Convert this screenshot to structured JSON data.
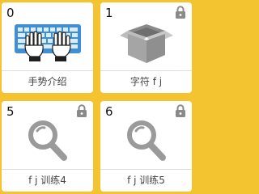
{
  "lessons": [
    {
      "number": "0",
      "label": "手势介绍",
      "locked": false,
      "icon": "keyboard-hands-icon"
    },
    {
      "number": "1",
      "label": "字符 f j",
      "locked": true,
      "icon": "open-box-icon"
    },
    {
      "number": "5",
      "label": "f j 训练4",
      "locked": true,
      "icon": "magnifier-icon"
    },
    {
      "number": "6",
      "label": "f j 训练5",
      "locked": true,
      "icon": "magnifier-icon"
    }
  ],
  "colors": {
    "background": "#f4c430",
    "tile": "#ffffff",
    "keyboard": "#3f8fd2",
    "icon_gray": "#9a9a9a",
    "lock_gray": "#8a8a8a"
  }
}
